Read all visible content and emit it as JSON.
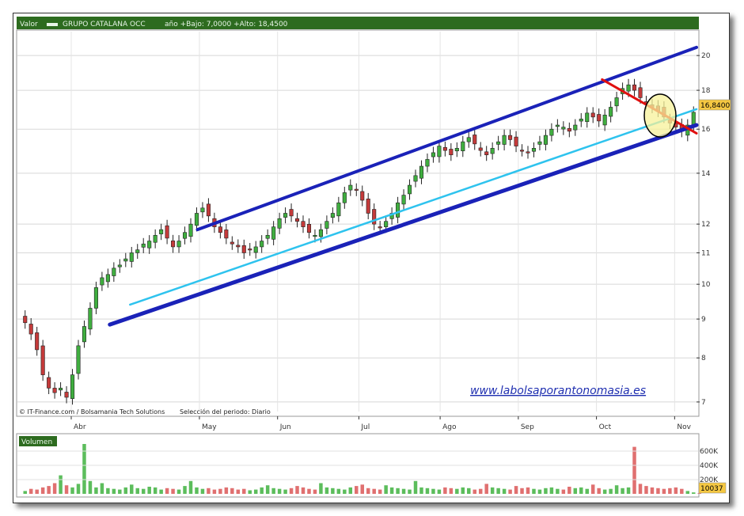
{
  "header": {
    "series_tag": "Valor",
    "instrument": "GRUPO CATALANA OCC",
    "range_text": "año +Bajo: 7,0000 +Alto: 18,4500"
  },
  "footer": {
    "credits": "© IT-Finance.com / Bolsamania Tech Solutions",
    "period": "Selección del periodo: Diario"
  },
  "watermark": "www.labolsaporantonomasia.es",
  "volume_panel_label": "Volumen",
  "last_price_label": "16,8400",
  "last_volume_label": "10037",
  "colors": {
    "up_candle": "#3fae3f",
    "down_candle": "#c43a3a",
    "volume_red": "#e07070",
    "volume_green": "#5cbd5c",
    "channel_dark": "#1a22b8",
    "channel_light": "#2ec3ee",
    "resistance_red": "#e01010",
    "header_bg": "#2d6b1f",
    "highlight_circle": "#f7f29a"
  },
  "chart_data": {
    "type": "candlestick",
    "scale": "log",
    "ylim": [
      6.8,
      21.5
    ],
    "y_ticks": [
      7,
      8,
      9,
      10,
      11,
      12,
      14,
      16,
      18,
      20
    ],
    "x_months": [
      "Abr",
      "May",
      "Jun",
      "Jul",
      "Ago",
      "Sep",
      "Oct",
      "Nov"
    ],
    "grid": true,
    "closes": [
      8.9,
      8.6,
      8.2,
      7.6,
      7.3,
      7.2,
      7.3,
      7.1,
      7.6,
      8.3,
      8.8,
      9.3,
      9.9,
      10.2,
      10.3,
      10.5,
      10.6,
      10.8,
      11.0,
      11.1,
      11.3,
      11.4,
      11.6,
      11.8,
      11.5,
      11.2,
      11.4,
      11.7,
      12.0,
      12.4,
      12.6,
      12.3,
      11.9,
      11.7,
      11.5,
      11.3,
      11.2,
      11.0,
      11.1,
      11.2,
      11.4,
      11.6,
      11.9,
      12.2,
      12.4,
      12.3,
      12.1,
      11.9,
      11.7,
      11.6,
      11.8,
      12.1,
      12.4,
      12.8,
      13.2,
      13.5,
      13.3,
      12.9,
      12.4,
      12.0,
      11.9,
      12.1,
      12.4,
      12.8,
      13.1,
      13.5,
      13.9,
      14.3,
      14.6,
      14.9,
      15.2,
      15.0,
      14.8,
      15.1,
      15.4,
      15.6,
      15.3,
      15.0,
      14.8,
      15.1,
      15.4,
      15.7,
      15.5,
      15.2,
      15.0,
      14.9,
      15.1,
      15.4,
      15.7,
      16.0,
      16.2,
      16.1,
      15.9,
      16.2,
      16.5,
      16.8,
      16.6,
      16.4,
      16.7,
      17.1,
      17.6,
      18.1,
      18.3,
      18.0,
      17.6,
      17.3,
      17.1,
      16.9,
      16.6,
      16.3,
      16.1,
      15.9,
      16.2,
      16.84
    ],
    "volumes_k": [
      40,
      70,
      60,
      90,
      110,
      150,
      260,
      120,
      90,
      140,
      700,
      180,
      90,
      150,
      80,
      70,
      60,
      90,
      130,
      80,
      70,
      100,
      90,
      60,
      80,
      70,
      60,
      110,
      180,
      90,
      70,
      80,
      60,
      70,
      90,
      80,
      60,
      70,
      50,
      60,
      90,
      120,
      80,
      70,
      60,
      80,
      110,
      90,
      70,
      60,
      150,
      90,
      80,
      70,
      60,
      90,
      110,
      130,
      80,
      70,
      60,
      120,
      90,
      80,
      70,
      60,
      180,
      90,
      80,
      70,
      60,
      90,
      80,
      70,
      90,
      80,
      60,
      70,
      140,
      90,
      80,
      70,
      60,
      110,
      80,
      90,
      70,
      60,
      80,
      90,
      70,
      60,
      100,
      80,
      90,
      70,
      130,
      80,
      60,
      70,
      120,
      80,
      90,
      660,
      140,
      110,
      90,
      80,
      70,
      80,
      90,
      70,
      40,
      20,
      10
    ],
    "trendlines": [
      {
        "style": "channel_upper",
        "from": [
          0.26,
          11.8
        ],
        "to": [
          1.0,
          20.5
        ]
      },
      {
        "style": "channel_lower",
        "from": [
          0.13,
          8.85
        ],
        "to": [
          1.0,
          16.2
        ]
      },
      {
        "style": "mid_light",
        "from": [
          0.16,
          9.4
        ],
        "to": [
          1.0,
          17.0
        ]
      },
      {
        "style": "resistance",
        "from": [
          0.86,
          18.6
        ],
        "to": [
          1.0,
          15.8
        ]
      }
    ]
  }
}
